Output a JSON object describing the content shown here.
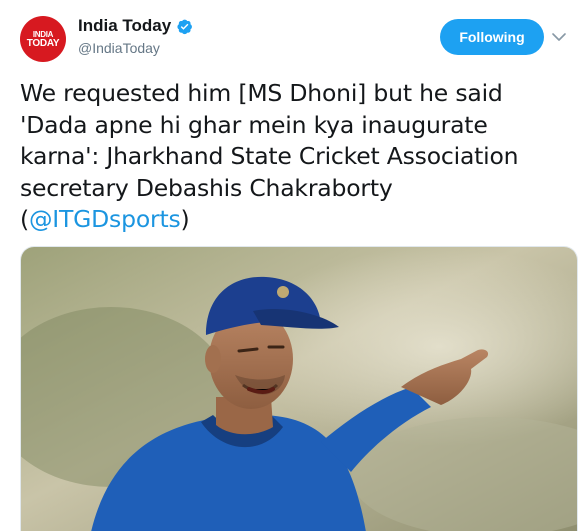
{
  "account": {
    "display_name": "India Today",
    "handle": "@IndiaToday",
    "avatar_logo_line1": "INDIA",
    "avatar_logo_line2": "TODAY",
    "verified": true
  },
  "follow_button": {
    "label": "Following"
  },
  "tweet": {
    "text_main": "We requested him [MS Dhoni] but he said 'Dada apne hi ghar mein kya inaugurate karna': Jharkhand State Cricket Association secretary Debashis Chakraborty (",
    "mention": "@ITGDsports",
    "text_tail": ")"
  },
  "colors": {
    "brand_blue": "#1da1f2",
    "mention_blue": "#1b95e0",
    "avatar_red": "#d71920",
    "jersey_blue": "#1f5fb8",
    "cap_blue": "#1c3f8f"
  },
  "icons": {
    "verified": "verified-badge-icon",
    "caret": "chevron-down-icon"
  }
}
